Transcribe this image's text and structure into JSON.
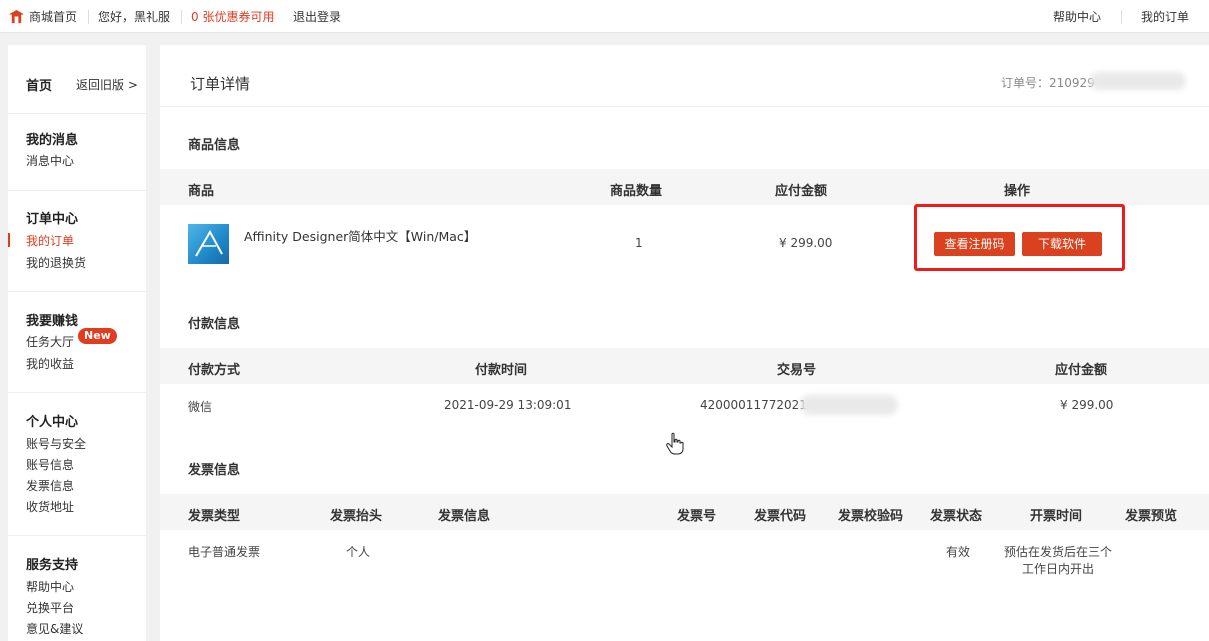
{
  "topbar": {
    "home": "商城首页",
    "greeting": "您好，黑礼服",
    "coupon": "0 张优惠券可用",
    "logout": "退出登录",
    "help": "帮助中心",
    "my_orders": "我的订单"
  },
  "sidebar": {
    "home": "首页",
    "back_old": "返回旧版 >",
    "sections": [
      {
        "title": "我的消息",
        "items": [
          "消息中心"
        ]
      },
      {
        "title": "订单中心",
        "items": [
          "我的订单",
          "我的退换货"
        ]
      },
      {
        "title": "我要赚钱",
        "items": [
          "任务大厅",
          "我的收益"
        ]
      },
      {
        "title": "个人中心",
        "items": [
          "账号与安全",
          "账号信息",
          "发票信息",
          "收货地址"
        ]
      },
      {
        "title": "服务支持",
        "items": [
          "帮助中心",
          "兑换平台",
          "意见&建议"
        ]
      }
    ],
    "new_badge": "New"
  },
  "order": {
    "title": "订单详情",
    "order_no": "订单号：210929"
  },
  "product_section": {
    "title": "商品信息",
    "headers": [
      "商品",
      "商品数量",
      "应付金额",
      "操作"
    ],
    "row": {
      "name": "Affinity Designer简体中文【Win/Mac】",
      "qty": "1",
      "amount": "¥ 299.00",
      "btn_reg": "查看注册码",
      "btn_download": "下载软件"
    }
  },
  "payment_section": {
    "title": "付款信息",
    "headers": [
      "付款方式",
      "付款时间",
      "交易号",
      "应付金额"
    ],
    "row": {
      "method": "微信",
      "time": "2021-09-29 13:09:01",
      "trade_no": "42000011772021",
      "amount": "¥ 299.00"
    }
  },
  "invoice_section": {
    "title": "发票信息",
    "headers": [
      "发票类型",
      "发票抬头",
      "发票信息",
      "发票号",
      "发票代码",
      "发票校验码",
      "发票状态",
      "开票时间",
      "发票预览"
    ],
    "row": {
      "type": "电子普通发票",
      "header": "个人",
      "status": "有效",
      "time_line1": "预估在发货后在三个",
      "time_line2": "工作日内开出"
    }
  },
  "colors": {
    "accent": "#e23b1f",
    "button": "#d9411f",
    "highlight": "#ef1b1b"
  }
}
